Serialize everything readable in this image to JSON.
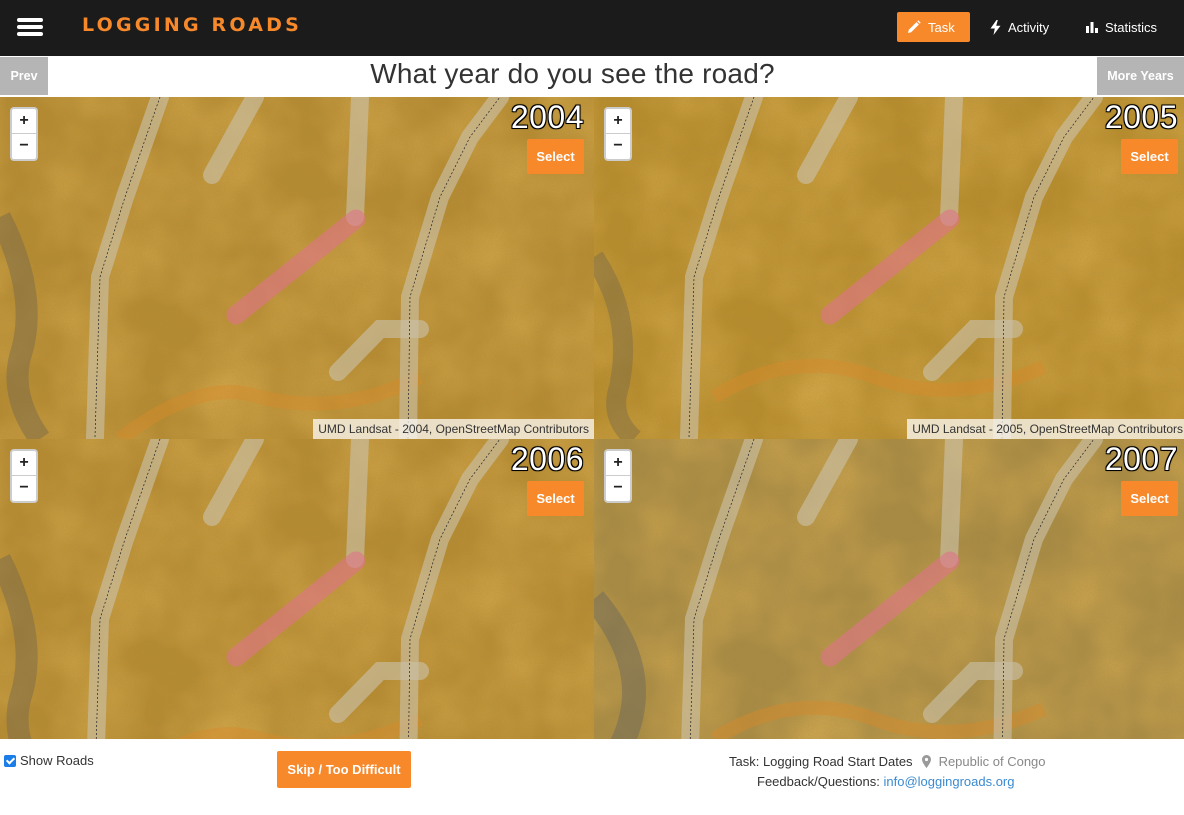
{
  "navbar": {
    "brand": "LOGGING ROADS",
    "items": [
      {
        "label": "Task",
        "icon": "pencil-icon",
        "active": true
      },
      {
        "label": "Activity",
        "icon": "lightning-icon",
        "active": false
      },
      {
        "label": "Statistics",
        "icon": "bar-chart-icon",
        "active": false
      }
    ]
  },
  "question_bar": {
    "prev_label": "Prev",
    "question": "What year do you see the road?",
    "more_label": "More Years"
  },
  "maps": [
    {
      "year": "2004",
      "select_label": "Select",
      "zoom_in": "+",
      "zoom_out": "−",
      "attribution": "UMD Landsat - 2004, OpenStreetMap Contributors"
    },
    {
      "year": "2005",
      "select_label": "Select",
      "zoom_in": "+",
      "zoom_out": "−",
      "attribution": "UMD Landsat - 2005, OpenStreetMap Contributors"
    },
    {
      "year": "2006",
      "select_label": "Select",
      "zoom_in": "+",
      "zoom_out": "−",
      "attribution": ""
    },
    {
      "year": "2007",
      "select_label": "Select",
      "zoom_in": "+",
      "zoom_out": "−",
      "attribution": ""
    }
  ],
  "footer": {
    "show_roads_label": "Show Roads",
    "show_roads_checked": true,
    "skip_label": "Skip / Too Difficult",
    "task_label": "Task: Logging Road Start Dates",
    "country": "Republic of Congo",
    "feedback_label": "Feedback/Questions:",
    "feedback_email": "info@loggingroads.org"
  },
  "colors": {
    "accent": "#f7892b",
    "navbar_bg": "#1b1b1b",
    "side_button_bg": "#b5b5b5",
    "road_highlight": "#e0738a",
    "link": "#3a8ad1"
  }
}
